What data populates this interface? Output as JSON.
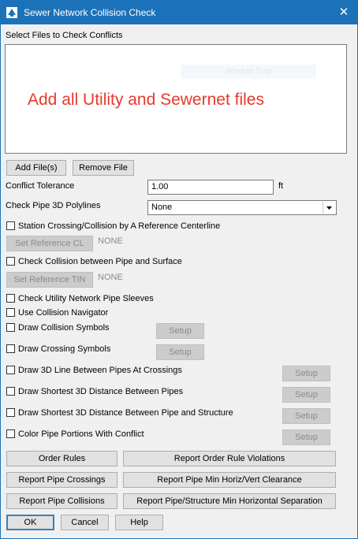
{
  "window": {
    "title": "Sewer Network Collision Check",
    "accent": "#1c72b8",
    "icon": "app-logo-icon"
  },
  "files": {
    "label": "Select Files to Check Conflicts",
    "annotation": "Add all Utility and Sewernet files",
    "ghost_text": "Window Snip",
    "annotation_color": "#e8392e"
  },
  "buttons": {
    "add_files": "Add File(s)",
    "remove_file": "Remove File"
  },
  "tolerance": {
    "label": "Conflict Tolerance",
    "value": "1.00",
    "unit": "ft"
  },
  "polylines": {
    "label": "Check Pipe 3D Polylines",
    "value": "None"
  },
  "reference_cl": {
    "label": "Station Crossing/Collision by A Reference Centerline",
    "button": "Set Reference CL",
    "value": "NONE",
    "checked": false
  },
  "surface": {
    "label": "Check Collision between Pipe and Surface",
    "button": "Set Reference TIN",
    "value": "NONE",
    "checked": false
  },
  "options": {
    "sleeves": "Check Utility Network Pipe Sleeves",
    "navigator": "Use Collision Navigator",
    "collision_symbols": "Draw Collision Symbols",
    "crossing_symbols": "Draw Crossing Symbols",
    "line_3d": "Draw 3D Line Between Pipes At Crossings",
    "shortest_pipes": "Draw Shortest 3D Distance Between Pipes",
    "shortest_structure": "Draw Shortest 3D Distance Between Pipe and Structure",
    "color_pipe": "Color Pipe Portions With Conflict",
    "setup": "Setup"
  },
  "reports": {
    "order_rules": "Order Rules",
    "order_violations": "Report Order Rule Violations",
    "crossings": "Report Pipe Crossings",
    "clearance": "Report Pipe Min Horiz/Vert Clearance",
    "collisions": "Report Pipe Collisions",
    "separation": "Report Pipe/Structure Min Horizontal Separation"
  },
  "footer": {
    "ok": "OK",
    "cancel": "Cancel",
    "help": "Help"
  }
}
